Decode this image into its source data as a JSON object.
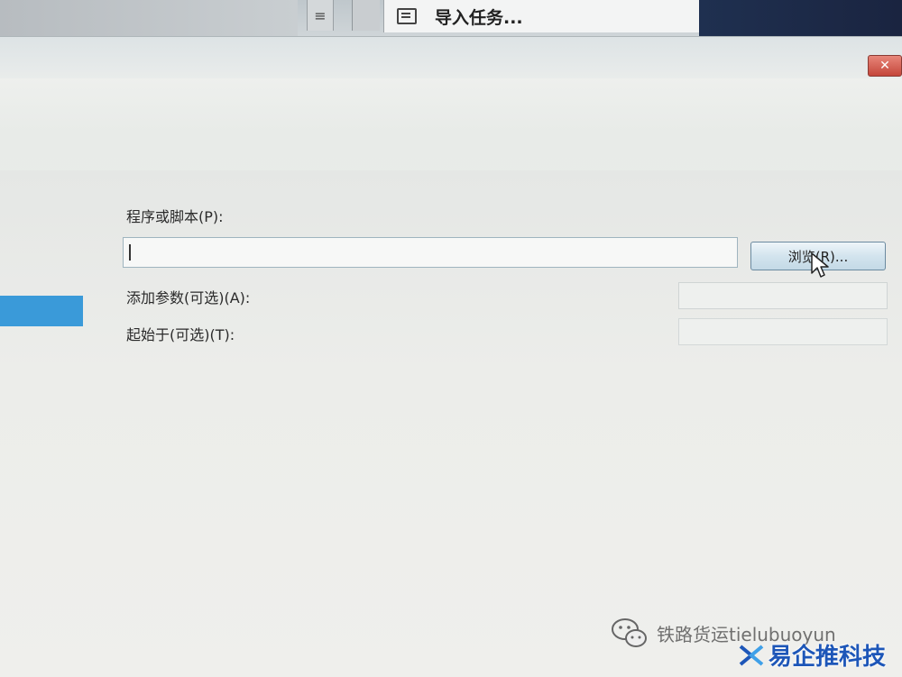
{
  "background": {
    "menu_item_label": "导入任务..."
  },
  "dialog": {
    "close_label": "✕",
    "program_label": "程序或脚本(P):",
    "program_value": "",
    "browse_label": "浏览(R)...",
    "args_label": "添加参数(可选)(A):",
    "start_label": "起始于(可选)(T):"
  },
  "watermark": {
    "source_text": "铁路货运tielubuoyun",
    "brand_text": "易企推科技"
  },
  "colors": {
    "accent": "#3a9ad9",
    "brand": "#1d56b8"
  }
}
